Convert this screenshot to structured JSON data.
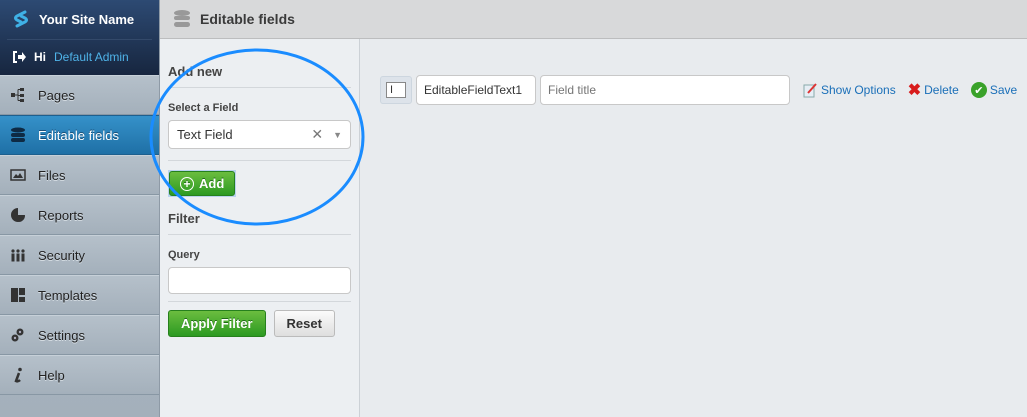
{
  "sidebar": {
    "site_name": "Your Site Name",
    "hi": "Hi",
    "user": "Default Admin",
    "items": [
      {
        "label": "Pages",
        "icon": "sitemap-icon"
      },
      {
        "label": "Editable fields",
        "icon": "database-icon",
        "active": true
      },
      {
        "label": "Files",
        "icon": "image-icon"
      },
      {
        "label": "Reports",
        "icon": "pie-chart-icon"
      },
      {
        "label": "Security",
        "icon": "users-icon"
      },
      {
        "label": "Templates",
        "icon": "layout-icon"
      },
      {
        "label": "Settings",
        "icon": "gears-icon"
      },
      {
        "label": "Help",
        "icon": "info-icon"
      }
    ]
  },
  "header": {
    "title": "Editable fields"
  },
  "panel": {
    "add_new": "Add new",
    "select_label": "Select a Field",
    "select_value": "Text Field",
    "add": "Add",
    "filter": "Filter",
    "query_label": "Query",
    "query_value": "",
    "apply": "Apply Filter",
    "reset": "Reset"
  },
  "row": {
    "type_value": "I",
    "name_value": "EditableFieldText1",
    "title_placeholder": "Field title",
    "show_options": "Show Options",
    "delete": "Delete",
    "save": "Save"
  },
  "colors": {
    "accent": "#2a8ac4",
    "green": "#3aa22a",
    "highlight": "#1a8cff",
    "link": "#1a6fb8"
  }
}
